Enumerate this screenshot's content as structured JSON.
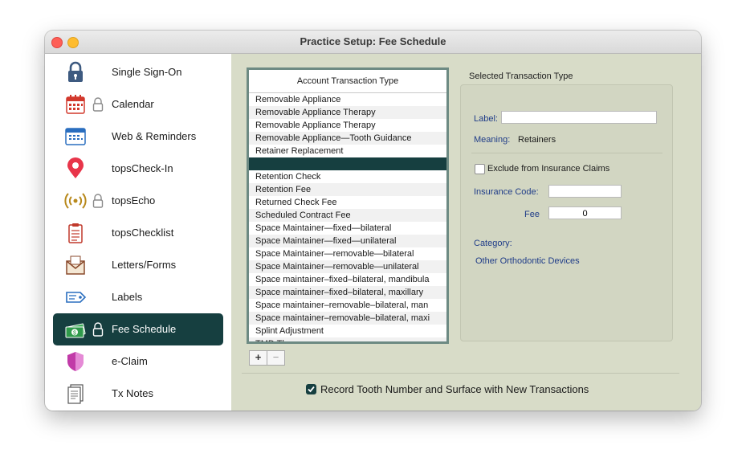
{
  "window": {
    "title": "Practice Setup: Fee Schedule"
  },
  "sidebar": {
    "items": [
      {
        "label": "Single Sign-On",
        "icon": "lock-icon",
        "locked": false,
        "selected": false
      },
      {
        "label": "Calendar",
        "icon": "calendar-icon",
        "locked": true,
        "selected": false
      },
      {
        "label": "Web & Reminders",
        "icon": "web-icon",
        "locked": false,
        "selected": false
      },
      {
        "label": "topsCheck-In",
        "icon": "map-pin-icon",
        "locked": false,
        "selected": false
      },
      {
        "label": "topsEcho",
        "icon": "broadcast-icon",
        "locked": true,
        "selected": false
      },
      {
        "label": "topsChecklist",
        "icon": "clipboard-icon",
        "locked": false,
        "selected": false
      },
      {
        "label": "Letters/Forms",
        "icon": "envelope-icon",
        "locked": false,
        "selected": false
      },
      {
        "label": "Labels",
        "icon": "tag-icon",
        "locked": false,
        "selected": false
      },
      {
        "label": "Fee Schedule",
        "icon": "money-icon",
        "locked": true,
        "selected": true
      },
      {
        "label": "e-Claim",
        "icon": "shield-icon",
        "locked": false,
        "selected": false
      },
      {
        "label": "Tx Notes",
        "icon": "notes-icon",
        "locked": false,
        "selected": false
      }
    ]
  },
  "list": {
    "header": "Account Transaction Type",
    "rows": [
      "Removable Appliance",
      "Removable Appliance Therapy",
      "Removable Appliance Therapy",
      "Removable Appliance—Tooth Guidance",
      "Retainer Replacement",
      "",
      "Retention Check",
      "Retention Fee",
      "Returned Check Fee",
      "Scheduled Contract Fee",
      "Space Maintainer—fixed—bilateral",
      "Space Maintainer—fixed—unilateral",
      "Space Maintainer—removable—bilateral",
      "Space Maintainer—removable—unilateral",
      "Space maintainer–fixed–bilateral, mandibula",
      "Space maintainer–fixed–bilateral, maxillary",
      "Space maintainer–removable–bilateral, man",
      "Space maintainer–removable–bilateral, maxi",
      "Splint Adjustment",
      "TMD Therapy"
    ],
    "selected_index": 5,
    "add_label": "+",
    "remove_label": "−"
  },
  "selected": {
    "title": "Selected Transaction Type",
    "label_label": "Label:",
    "label_value": "",
    "meaning_label": "Meaning:",
    "meaning_value": "Retainers",
    "exclude_label": "Exclude from Insurance Claims",
    "exclude_checked": false,
    "insurance_code_label": "Insurance Code:",
    "insurance_code_value": "",
    "fee_label": "Fee",
    "fee_value": "0",
    "category_label": "Category:",
    "category_value": "Other Orthodontic Devices"
  },
  "footer": {
    "record_label": "Record Tooth Number and Surface with New Transactions",
    "record_checked": true
  },
  "colors": {
    "accent": "#163f40",
    "panel_bg": "#d8dcc8",
    "field_label": "#1f3c88"
  }
}
